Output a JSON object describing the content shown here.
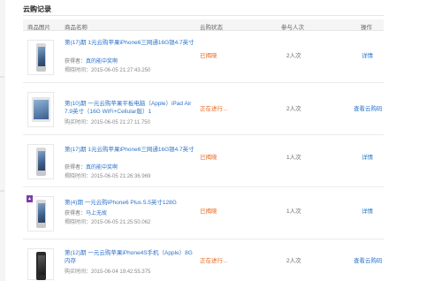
{
  "section": {
    "title": "云购记录"
  },
  "table": {
    "headers": {
      "image": "商品图片",
      "name": "商品名称",
      "status": "云购状态",
      "count": "参与人次",
      "op": "操作"
    }
  },
  "rows": [
    {
      "name": "第(17)期 1元云购苹果iPhone6三网通16G银4.7英寸",
      "winner_label": "获得者：",
      "winner_name": "真的能中奖啊",
      "time": "揭晓时间：2015-06-05 21:27:43.250",
      "status": "已揭晓",
      "count": "2人次",
      "op": "详情"
    },
    {
      "name": "第(10)期 一元云购苹果平板电脑（Apple）iPad Air 7.9英寸（16G WiFi+Cellular版）1",
      "time": "购买时间：2015-06-05 21:27:11.750",
      "status": "正在进行...",
      "count": "2人次",
      "op": "查看云购码"
    },
    {
      "name": "第(17)期 1元云购苹果iPhone6三网通16G银4.7英寸",
      "winner_label": "获得者：",
      "winner_name": "真的能中奖啊",
      "time": "揭晓时间：2015-06-05 21:26:36.969",
      "status": "已揭晓",
      "count": "1人次",
      "op": "详情"
    },
    {
      "name": "第(4)期 一元云购iPhone6 Plus 5.5英寸128G",
      "winner_label": "获得者：",
      "winner_name": "马上无故",
      "time": "揭晓时间：2015-06-05 21:25:50.062",
      "status": "已揭晓",
      "count": "1人次",
      "op": "详情"
    },
    {
      "name": "第(12)期 一元云购苹果iPhone4S手机（Apple）8G内存",
      "time": "购买时间：2015-06-04 19:42:55.375",
      "status": "正在进行...",
      "count": "2人次",
      "op": "查看云购码"
    }
  ]
}
